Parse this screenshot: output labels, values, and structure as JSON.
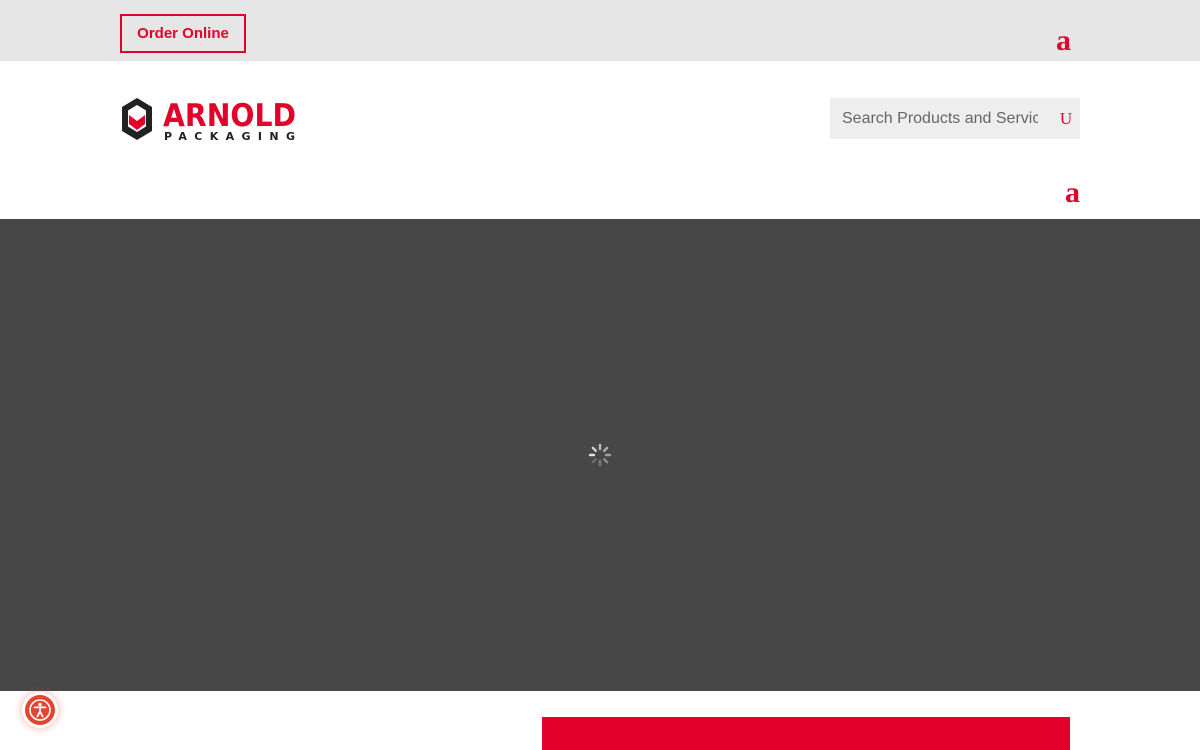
{
  "topbar": {
    "order_label": "Order Online",
    "icon_glyph": "a",
    "icon_name": "cart-icon"
  },
  "header": {
    "logo": {
      "brand": "ARNOLD",
      "tagline": "PACKAGING"
    },
    "search": {
      "placeholder": "Search Products and Services",
      "icon_glyph": "U",
      "icon_name": "search-icon"
    },
    "menu": {
      "icon_glyph": "a",
      "icon_name": "menu-icon"
    }
  },
  "hero": {
    "state": "loading"
  },
  "accessibility": {
    "icon_name": "accessibility-icon"
  },
  "colors": {
    "brand_red": "#e3002b",
    "topbar_bg": "#e6e6e6",
    "hero_bg": "#474747",
    "search_bg": "#eeeeee",
    "accessibility_bg": "#e3462f"
  }
}
